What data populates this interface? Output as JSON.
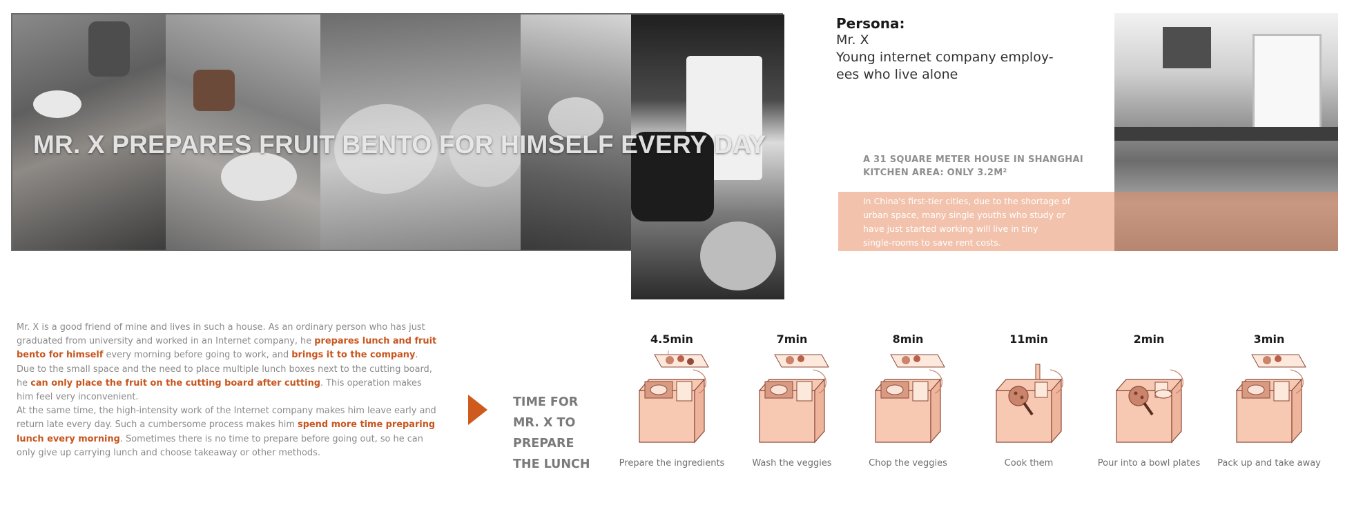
{
  "hero": {
    "title": "MR. X PREPARES FRUIT BENTO FOR HIMSELF EVERY DAY"
  },
  "persona": {
    "label": "Persona:",
    "name": "Mr. X",
    "desc_line1": "Young internet company employ-",
    "desc_line2": "ees who live alone"
  },
  "house": {
    "line1": "A 31 SQUARE METER HOUSE IN SHANGHAI",
    "line2": "KITCHEN AREA: ONLY 3.2M²"
  },
  "band": {
    "line1": "In China's first-tier cities, due to the shortage of",
    "line2": "urban space, many single youths who study or",
    "line3": "have just started working will live in tiny",
    "line4": "single-rooms to save rent costs."
  },
  "story": {
    "s1": "Mr. X is a good friend of mine and lives in such a house. As an ordinary person who has just graduated from university and worked in an Internet company, he ",
    "h1": "prepares lunch and fruit bento for himself",
    "s2": " every morning before going to work, and ",
    "h2": "brings it to the company",
    "s3": ".",
    "s4": "Due to the small space and the need to place multiple lunch boxes next to the cutting board, he ",
    "h3": "can only place the fruit on the cutting board after cutting",
    "s5": ". This operation makes him feel very inconvenient.",
    "s6": "At the same time, the high-intensity work of the Internet company makes him leave early and return late every day. Such a cumbersome process makes him ",
    "h4": "spend more time preparing lunch every morning",
    "s7": ". Sometimes there is no time to prepare before going out, so he can only give up carrying lunch and choose takeaway or other methods."
  },
  "time_title": {
    "l1": "TIME FOR",
    "l2": "MR. X TO",
    "l3": "PREPARE",
    "l4": "THE LUNCH"
  },
  "steps": [
    {
      "duration": "4.5min",
      "caption": "Prepare the ingredients",
      "icon": "ingredients-box-icon"
    },
    {
      "duration": "7min",
      "caption": "Wash the veggies",
      "icon": "wash-box-icon"
    },
    {
      "duration": "8min",
      "caption": "Chop the veggies",
      "icon": "chop-box-icon"
    },
    {
      "duration": "11min",
      "caption": "Cook them",
      "icon": "cook-box-icon"
    },
    {
      "duration": "2min",
      "caption": "Pour into a bowl plates",
      "icon": "pour-box-icon"
    },
    {
      "duration": "3min",
      "caption": "Pack up and take away",
      "icon": "pack-box-icon"
    }
  ],
  "colors": {
    "accent": "#c8551d",
    "box_fill": "#f7c8b2",
    "box_stroke": "#8a4a3a",
    "band": "#f2c2ac"
  }
}
